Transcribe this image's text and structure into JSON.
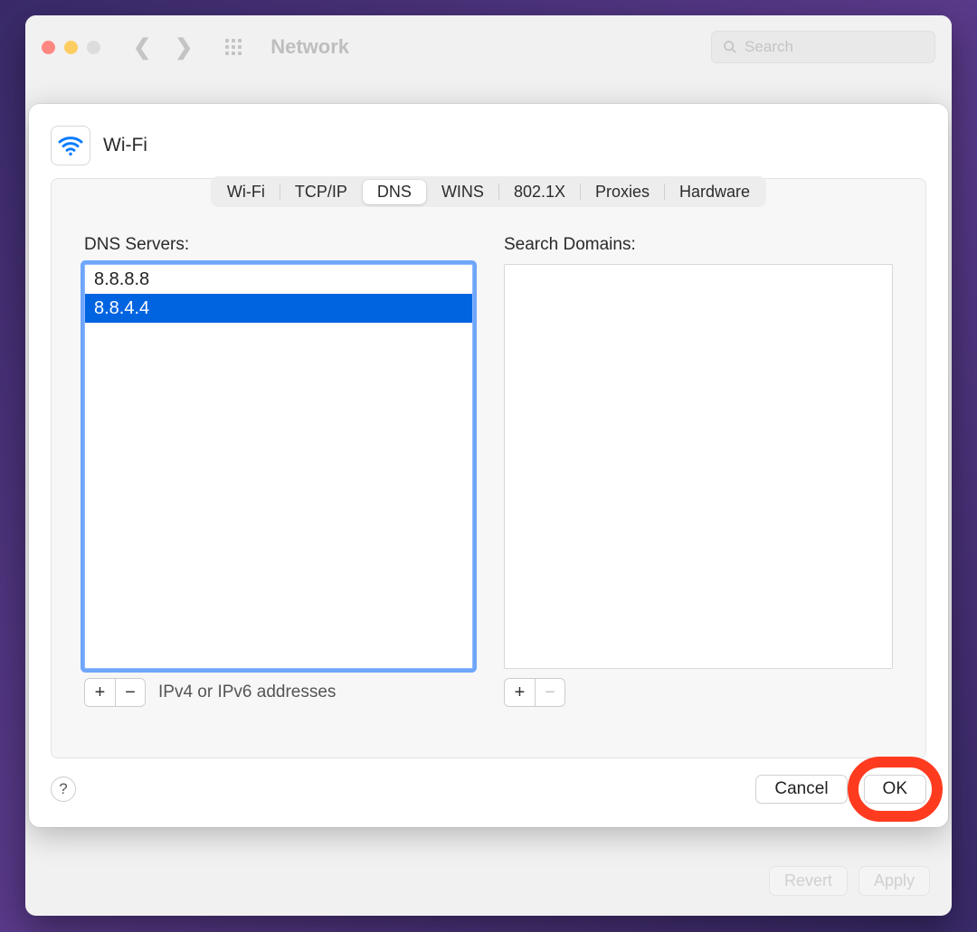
{
  "window": {
    "title": "Network",
    "search_placeholder": "Search",
    "back_actions": {
      "revert": "Revert",
      "apply": "Apply"
    }
  },
  "sheet": {
    "title": "Wi-Fi",
    "tabs": [
      "Wi-Fi",
      "TCP/IP",
      "DNS",
      "WINS",
      "802.1X",
      "Proxies",
      "Hardware"
    ],
    "active_tab_index": 2,
    "dns": {
      "servers_label": "DNS Servers:",
      "servers": [
        "8.8.8.8",
        "8.8.4.4"
      ],
      "selected_server_index": 1,
      "hint": "IPv4 or IPv6 addresses",
      "domains_label": "Search Domains:",
      "domains": []
    },
    "buttons": {
      "help": "?",
      "cancel": "Cancel",
      "ok": "OK"
    }
  }
}
